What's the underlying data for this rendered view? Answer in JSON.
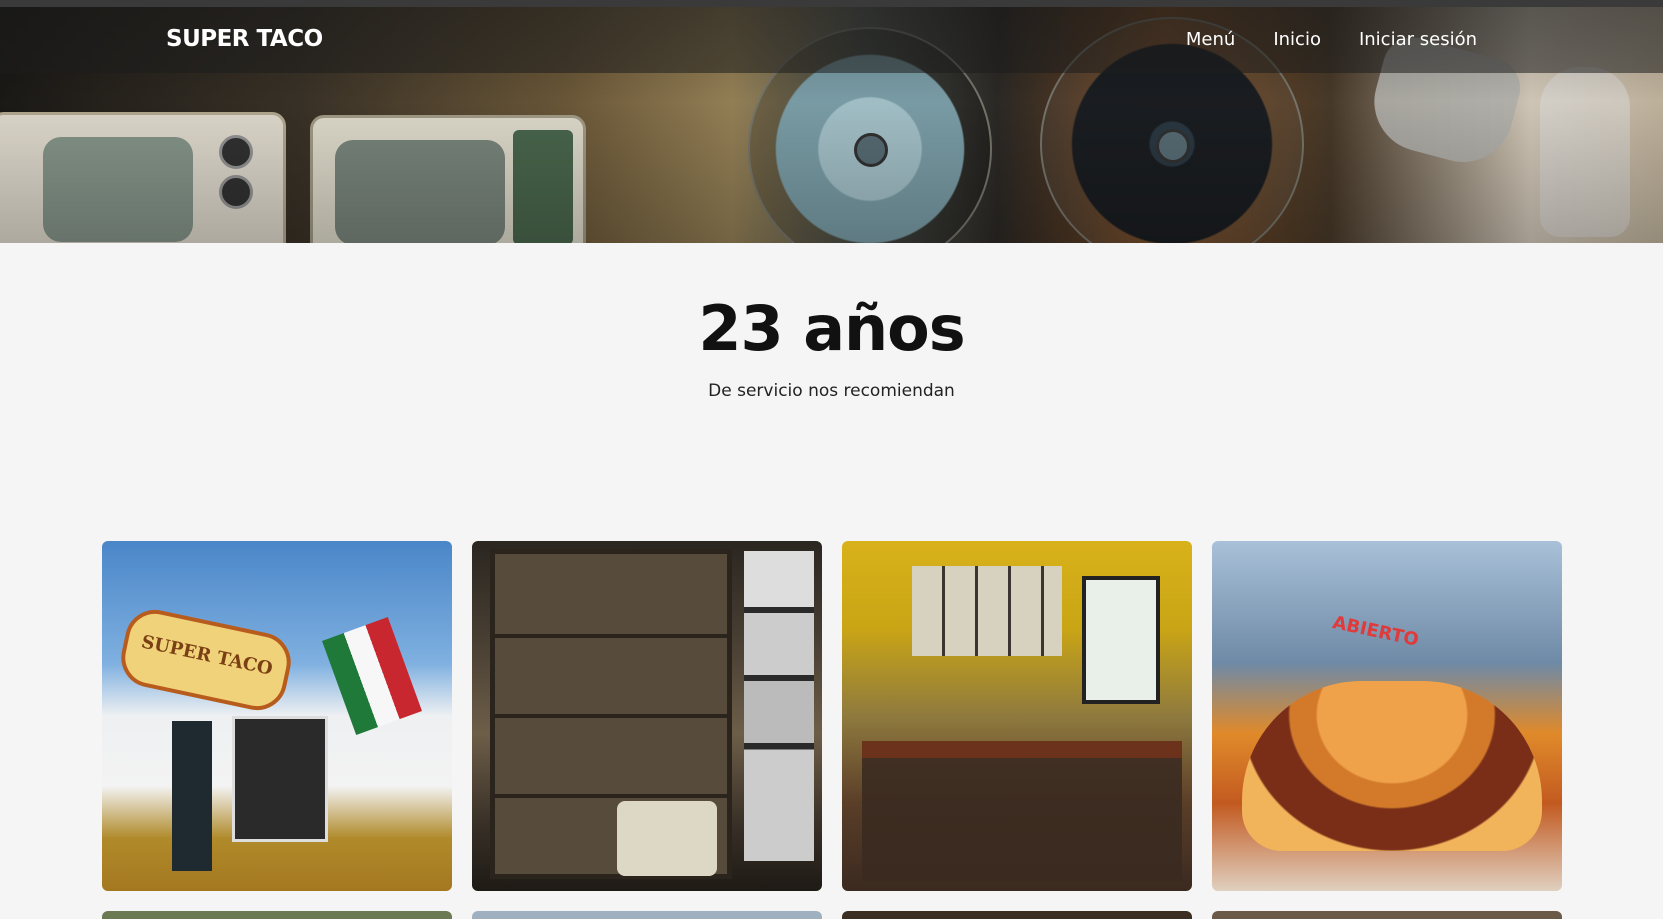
{
  "header": {
    "brand": "SUPER TACO",
    "nav": [
      {
        "label": "Menú"
      },
      {
        "label": "Inicio"
      },
      {
        "label": "Iniciar sesión"
      }
    ]
  },
  "hero_section": {
    "headline": "23 años",
    "subline": "De servicio nos recomiendan"
  },
  "gallery": {
    "cards": [
      {
        "sign_text": "SUPER TACO"
      },
      {},
      {},
      {
        "sign_text": "ABIERTO"
      }
    ]
  },
  "colors": {
    "nav_bg": "#1e1e1e",
    "page_bg": "#f5f5f5",
    "text": "#111111"
  }
}
